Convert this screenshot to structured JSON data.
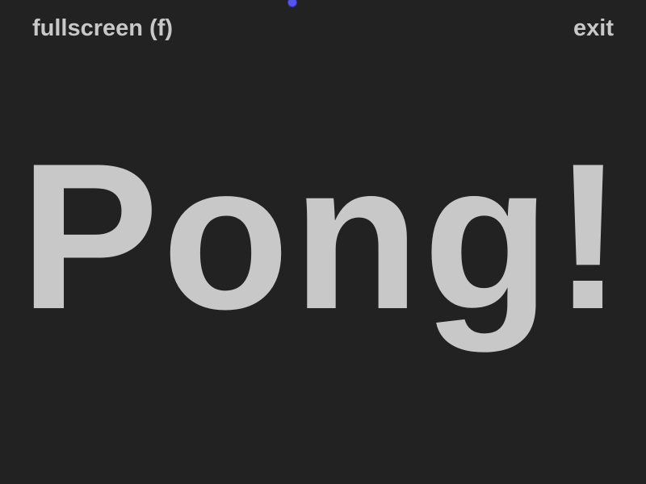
{
  "menu": {
    "fullscreen_label": "fullscreen (f)",
    "exit_label": "exit"
  },
  "title": "Pong!",
  "colors": {
    "background": "#222222",
    "text": "#c8c8c8",
    "ball": "#5555ee"
  }
}
